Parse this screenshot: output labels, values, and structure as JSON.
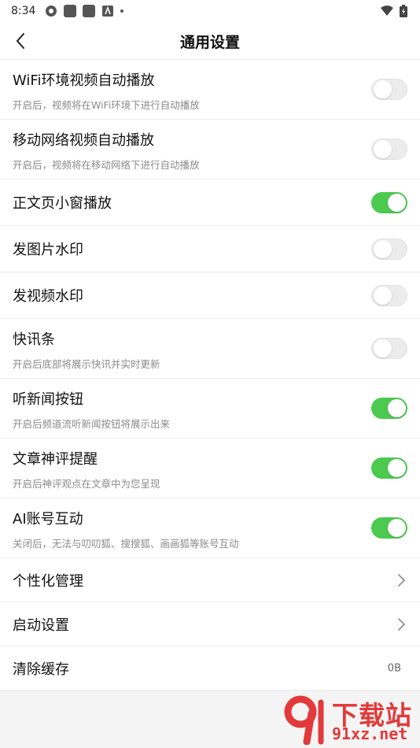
{
  "status_bar": {
    "time": "8:34"
  },
  "header": {
    "title": "通用设置"
  },
  "settings": [
    {
      "title": "WiFi环境视频自动播放",
      "desc": "开启后，视频将在WiFi环境下进行自动播放",
      "enabled": false
    },
    {
      "title": "移动网络视频自动播放",
      "desc": "开启后，视频将在移动网络下进行自动播放",
      "enabled": false
    },
    {
      "title": "正文页小窗播放",
      "desc": "",
      "enabled": true
    },
    {
      "title": "发图片水印",
      "desc": "",
      "enabled": false
    },
    {
      "title": "发视频水印",
      "desc": "",
      "enabled": false
    },
    {
      "title": "快讯条",
      "desc": "开启后底部将展示快讯并实时更新",
      "enabled": false
    },
    {
      "title": "听新闻按钮",
      "desc": "开启后频道流听新闻按钮将展示出来",
      "enabled": true
    },
    {
      "title": "文章神评提醒",
      "desc": "开启后神评观点在文章中为您呈现",
      "enabled": true
    },
    {
      "title": "AI账号互动",
      "desc": "关闭后，无法与叨叨狐、搜搜狐、画画狐等账号互动",
      "enabled": true
    }
  ],
  "nav_items": [
    {
      "title": "个性化管理"
    },
    {
      "title": "启动设置"
    }
  ],
  "cache": {
    "title": "清除缓存",
    "value": "0B"
  },
  "watermark": {
    "line1": "下载站",
    "line2": "91xz.net"
  },
  "colors": {
    "toggle_on": "#4cc94f",
    "toggle_off": "#ececec",
    "watermark": "#e23a3a"
  }
}
